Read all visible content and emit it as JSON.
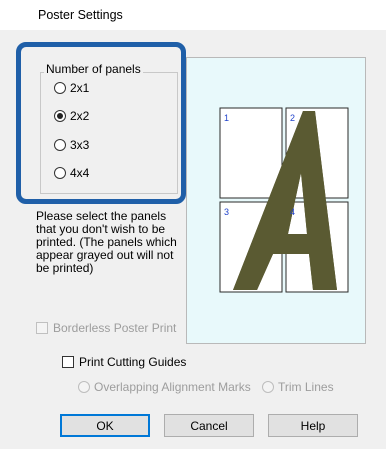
{
  "dialog": {
    "title": "Poster Settings"
  },
  "panels_group": {
    "legend": "Number of panels",
    "options": [
      {
        "label": "2x1",
        "checked": false
      },
      {
        "label": "2x2",
        "checked": true
      },
      {
        "label": "3x3",
        "checked": false
      },
      {
        "label": "4x4",
        "checked": false
      }
    ]
  },
  "hint_text": "Please select the panels that you don't wish to be printed. (The panels which appear grayed out will not be printed)",
  "preview": {
    "panels": [
      "1",
      "2",
      "3",
      "4"
    ],
    "glyph_color": "#5a5a32"
  },
  "options": {
    "borderless_label": "Borderless Poster Print",
    "cutting_guides_label": "Print Cutting Guides",
    "overlap_label": "Overlapping Alignment Marks",
    "trim_label": "Trim Lines"
  },
  "buttons": {
    "ok": "OK",
    "cancel": "Cancel",
    "help": "Help"
  },
  "colors": {
    "highlight": "#1f5fa8",
    "preview_bg": "#e8f9fb",
    "default_button_border": "#0078d7"
  }
}
